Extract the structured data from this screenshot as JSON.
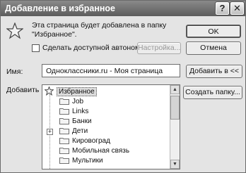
{
  "window": {
    "title": "Добавление в избранное",
    "help_button": "?",
    "close_button": "✕"
  },
  "message": "Эта страница будет добавлена в папку \"Избранное\".",
  "offline": {
    "checkbox_label": "Сделать доступной автономно",
    "checked": false,
    "settings_button": "Настройка..."
  },
  "buttons": {
    "ok": "OK",
    "cancel": "Отмена",
    "add_to": "Добавить в <<",
    "new_folder": "Создать папку..."
  },
  "name_field": {
    "label": "Имя:",
    "value": "Одноклассники.ru - Моя страница"
  },
  "tree": {
    "label": "Добавить в:",
    "root": "Избранное",
    "folders": [
      "Job",
      "Links",
      "Банки",
      "Дети",
      "Кировоград",
      "Мобильная связь",
      "Мультики"
    ],
    "expandable_folder": "Дети"
  }
}
